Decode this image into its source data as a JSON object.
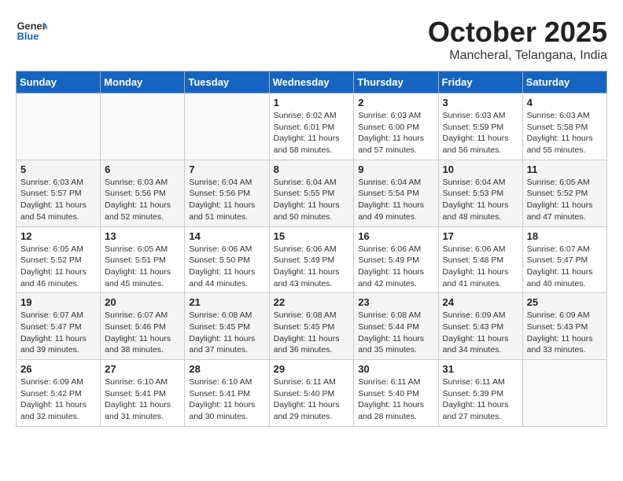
{
  "header": {
    "logo_general": "General",
    "logo_blue": "Blue",
    "month_title": "October 2025",
    "location": "Mancheral, Telangana, India"
  },
  "weekdays": [
    "Sunday",
    "Monday",
    "Tuesday",
    "Wednesday",
    "Thursday",
    "Friday",
    "Saturday"
  ],
  "weeks": [
    [
      {
        "day": "",
        "info": ""
      },
      {
        "day": "",
        "info": ""
      },
      {
        "day": "",
        "info": ""
      },
      {
        "day": "1",
        "info": "Sunrise: 6:02 AM\nSunset: 6:01 PM\nDaylight: 11 hours and 58 minutes."
      },
      {
        "day": "2",
        "info": "Sunrise: 6:03 AM\nSunset: 6:00 PM\nDaylight: 11 hours and 57 minutes."
      },
      {
        "day": "3",
        "info": "Sunrise: 6:03 AM\nSunset: 5:59 PM\nDaylight: 11 hours and 56 minutes."
      },
      {
        "day": "4",
        "info": "Sunrise: 6:03 AM\nSunset: 5:58 PM\nDaylight: 11 hours and 55 minutes."
      }
    ],
    [
      {
        "day": "5",
        "info": "Sunrise: 6:03 AM\nSunset: 5:57 PM\nDaylight: 11 hours and 54 minutes."
      },
      {
        "day": "6",
        "info": "Sunrise: 6:03 AM\nSunset: 5:56 PM\nDaylight: 11 hours and 52 minutes."
      },
      {
        "day": "7",
        "info": "Sunrise: 6:04 AM\nSunset: 5:56 PM\nDaylight: 11 hours and 51 minutes."
      },
      {
        "day": "8",
        "info": "Sunrise: 6:04 AM\nSunset: 5:55 PM\nDaylight: 11 hours and 50 minutes."
      },
      {
        "day": "9",
        "info": "Sunrise: 6:04 AM\nSunset: 5:54 PM\nDaylight: 11 hours and 49 minutes."
      },
      {
        "day": "10",
        "info": "Sunrise: 6:04 AM\nSunset: 5:53 PM\nDaylight: 11 hours and 48 minutes."
      },
      {
        "day": "11",
        "info": "Sunrise: 6:05 AM\nSunset: 5:52 PM\nDaylight: 11 hours and 47 minutes."
      }
    ],
    [
      {
        "day": "12",
        "info": "Sunrise: 6:05 AM\nSunset: 5:52 PM\nDaylight: 11 hours and 46 minutes."
      },
      {
        "day": "13",
        "info": "Sunrise: 6:05 AM\nSunset: 5:51 PM\nDaylight: 11 hours and 45 minutes."
      },
      {
        "day": "14",
        "info": "Sunrise: 6:06 AM\nSunset: 5:50 PM\nDaylight: 11 hours and 44 minutes."
      },
      {
        "day": "15",
        "info": "Sunrise: 6:06 AM\nSunset: 5:49 PM\nDaylight: 11 hours and 43 minutes."
      },
      {
        "day": "16",
        "info": "Sunrise: 6:06 AM\nSunset: 5:49 PM\nDaylight: 11 hours and 42 minutes."
      },
      {
        "day": "17",
        "info": "Sunrise: 6:06 AM\nSunset: 5:48 PM\nDaylight: 11 hours and 41 minutes."
      },
      {
        "day": "18",
        "info": "Sunrise: 6:07 AM\nSunset: 5:47 PM\nDaylight: 11 hours and 40 minutes."
      }
    ],
    [
      {
        "day": "19",
        "info": "Sunrise: 6:07 AM\nSunset: 5:47 PM\nDaylight: 11 hours and 39 minutes."
      },
      {
        "day": "20",
        "info": "Sunrise: 6:07 AM\nSunset: 5:46 PM\nDaylight: 11 hours and 38 minutes."
      },
      {
        "day": "21",
        "info": "Sunrise: 6:08 AM\nSunset: 5:45 PM\nDaylight: 11 hours and 37 minutes."
      },
      {
        "day": "22",
        "info": "Sunrise: 6:08 AM\nSunset: 5:45 PM\nDaylight: 11 hours and 36 minutes."
      },
      {
        "day": "23",
        "info": "Sunrise: 6:08 AM\nSunset: 5:44 PM\nDaylight: 11 hours and 35 minutes."
      },
      {
        "day": "24",
        "info": "Sunrise: 6:09 AM\nSunset: 5:43 PM\nDaylight: 11 hours and 34 minutes."
      },
      {
        "day": "25",
        "info": "Sunrise: 6:09 AM\nSunset: 5:43 PM\nDaylight: 11 hours and 33 minutes."
      }
    ],
    [
      {
        "day": "26",
        "info": "Sunrise: 6:09 AM\nSunset: 5:42 PM\nDaylight: 11 hours and 32 minutes."
      },
      {
        "day": "27",
        "info": "Sunrise: 6:10 AM\nSunset: 5:41 PM\nDaylight: 11 hours and 31 minutes."
      },
      {
        "day": "28",
        "info": "Sunrise: 6:10 AM\nSunset: 5:41 PM\nDaylight: 11 hours and 30 minutes."
      },
      {
        "day": "29",
        "info": "Sunrise: 6:11 AM\nSunset: 5:40 PM\nDaylight: 11 hours and 29 minutes."
      },
      {
        "day": "30",
        "info": "Sunrise: 6:11 AM\nSunset: 5:40 PM\nDaylight: 11 hours and 28 minutes."
      },
      {
        "day": "31",
        "info": "Sunrise: 6:11 AM\nSunset: 5:39 PM\nDaylight: 11 hours and 27 minutes."
      },
      {
        "day": "",
        "info": ""
      }
    ]
  ]
}
